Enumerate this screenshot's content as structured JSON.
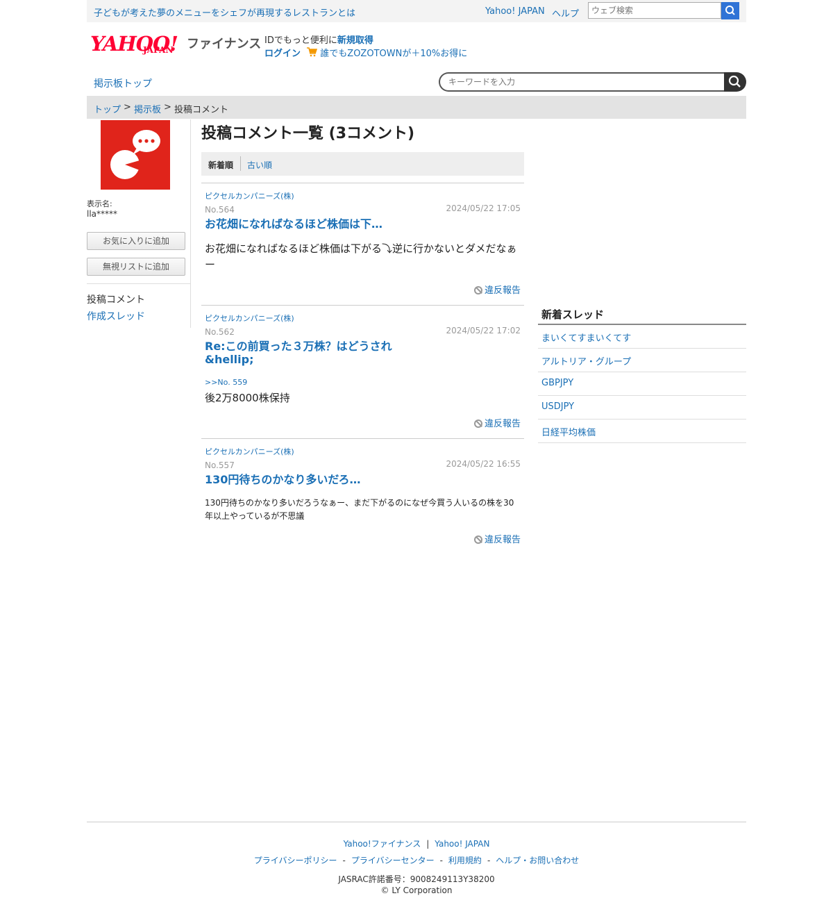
{
  "topbar": {
    "promo_text": "子どもが考えた夢のメニューをシェフが再現するレストランとは",
    "yahoo_japan_link": "Yahoo! JAPAN",
    "help_link": "ヘルプ",
    "web_search_placeholder": "ウェブ検索"
  },
  "header": {
    "logo_yahoo": "YAHOO!",
    "logo_japan": "JAPAN",
    "logo_finance": "ファイナンス",
    "id_prefix": "IDでもっと便利に",
    "signup_link": "新規取得",
    "login_link": "ログイン",
    "zozo_text": "誰でもZOZOTOWNが＋10%お得に"
  },
  "nav": {
    "board_top": "掲示板トップ",
    "keyword_placeholder": "キーワードを入力"
  },
  "breadcrumb": {
    "items": [
      "トップ",
      "掲示板",
      "投稿コメント"
    ],
    "separator": ">"
  },
  "profile": {
    "display_name_label": "表示名:",
    "display_name": "lla*****",
    "favorite_button": "お気に入りに追加",
    "ignore_button": "無視リストに追加",
    "menu_comments": "投稿コメント",
    "menu_threads": "作成スレッド",
    "avatar_color": "#e0241b"
  },
  "main": {
    "title": "投稿コメント一覧 (3コメント)",
    "sort_new": "新着順",
    "sort_old": "古い順",
    "posts": [
      {
        "company": "ピクセルカンパニーズ(株)",
        "no": "No.564",
        "date": "2024/05/22 17:05",
        "title": "お花畑になればなるほど株価は下…",
        "body": "お花畑になればなるほど株価は下がる⤵︎逆に行かないとダメだなぁー",
        "report": "違反報告"
      },
      {
        "company": "ピクセルカンパニーズ(株)",
        "no": "No.562",
        "date": "2024/05/22 17:02",
        "title": "Re:この前買った３万株？はどうされ&hellip;",
        "reply_to": ">>No. 559",
        "body": "後2万8000株保持",
        "report": "違反報告"
      },
      {
        "company": "ピクセルカンパニーズ(株)",
        "no": "No.557",
        "date": "2024/05/22 16:55",
        "title": "130円待ちのかなり多いだろ…",
        "body": "130円待ちのかなり多いだろうなぁー、まだ下がるのになぜ今買う人いるの株を30年以上やっているが不思議",
        "report": "違反報告"
      }
    ]
  },
  "sidebar": {
    "title": "新着スレッド",
    "threads": [
      "まいくてすまいくてす",
      "アルトリア・グループ",
      "GBPJPY",
      "USDJPY",
      "日経平均株価"
    ]
  },
  "footer": {
    "links_row1": [
      "Yahoo!ファイナンス",
      "Yahoo! JAPAN"
    ],
    "links_row2": [
      "プライバシーポリシー",
      "プライバシーセンター",
      "利用規約",
      "ヘルプ・お問い合わせ"
    ],
    "jasrac": "JASRAC許諾番号：9008249113Y38200",
    "copyright": "© LY Corporation"
  }
}
